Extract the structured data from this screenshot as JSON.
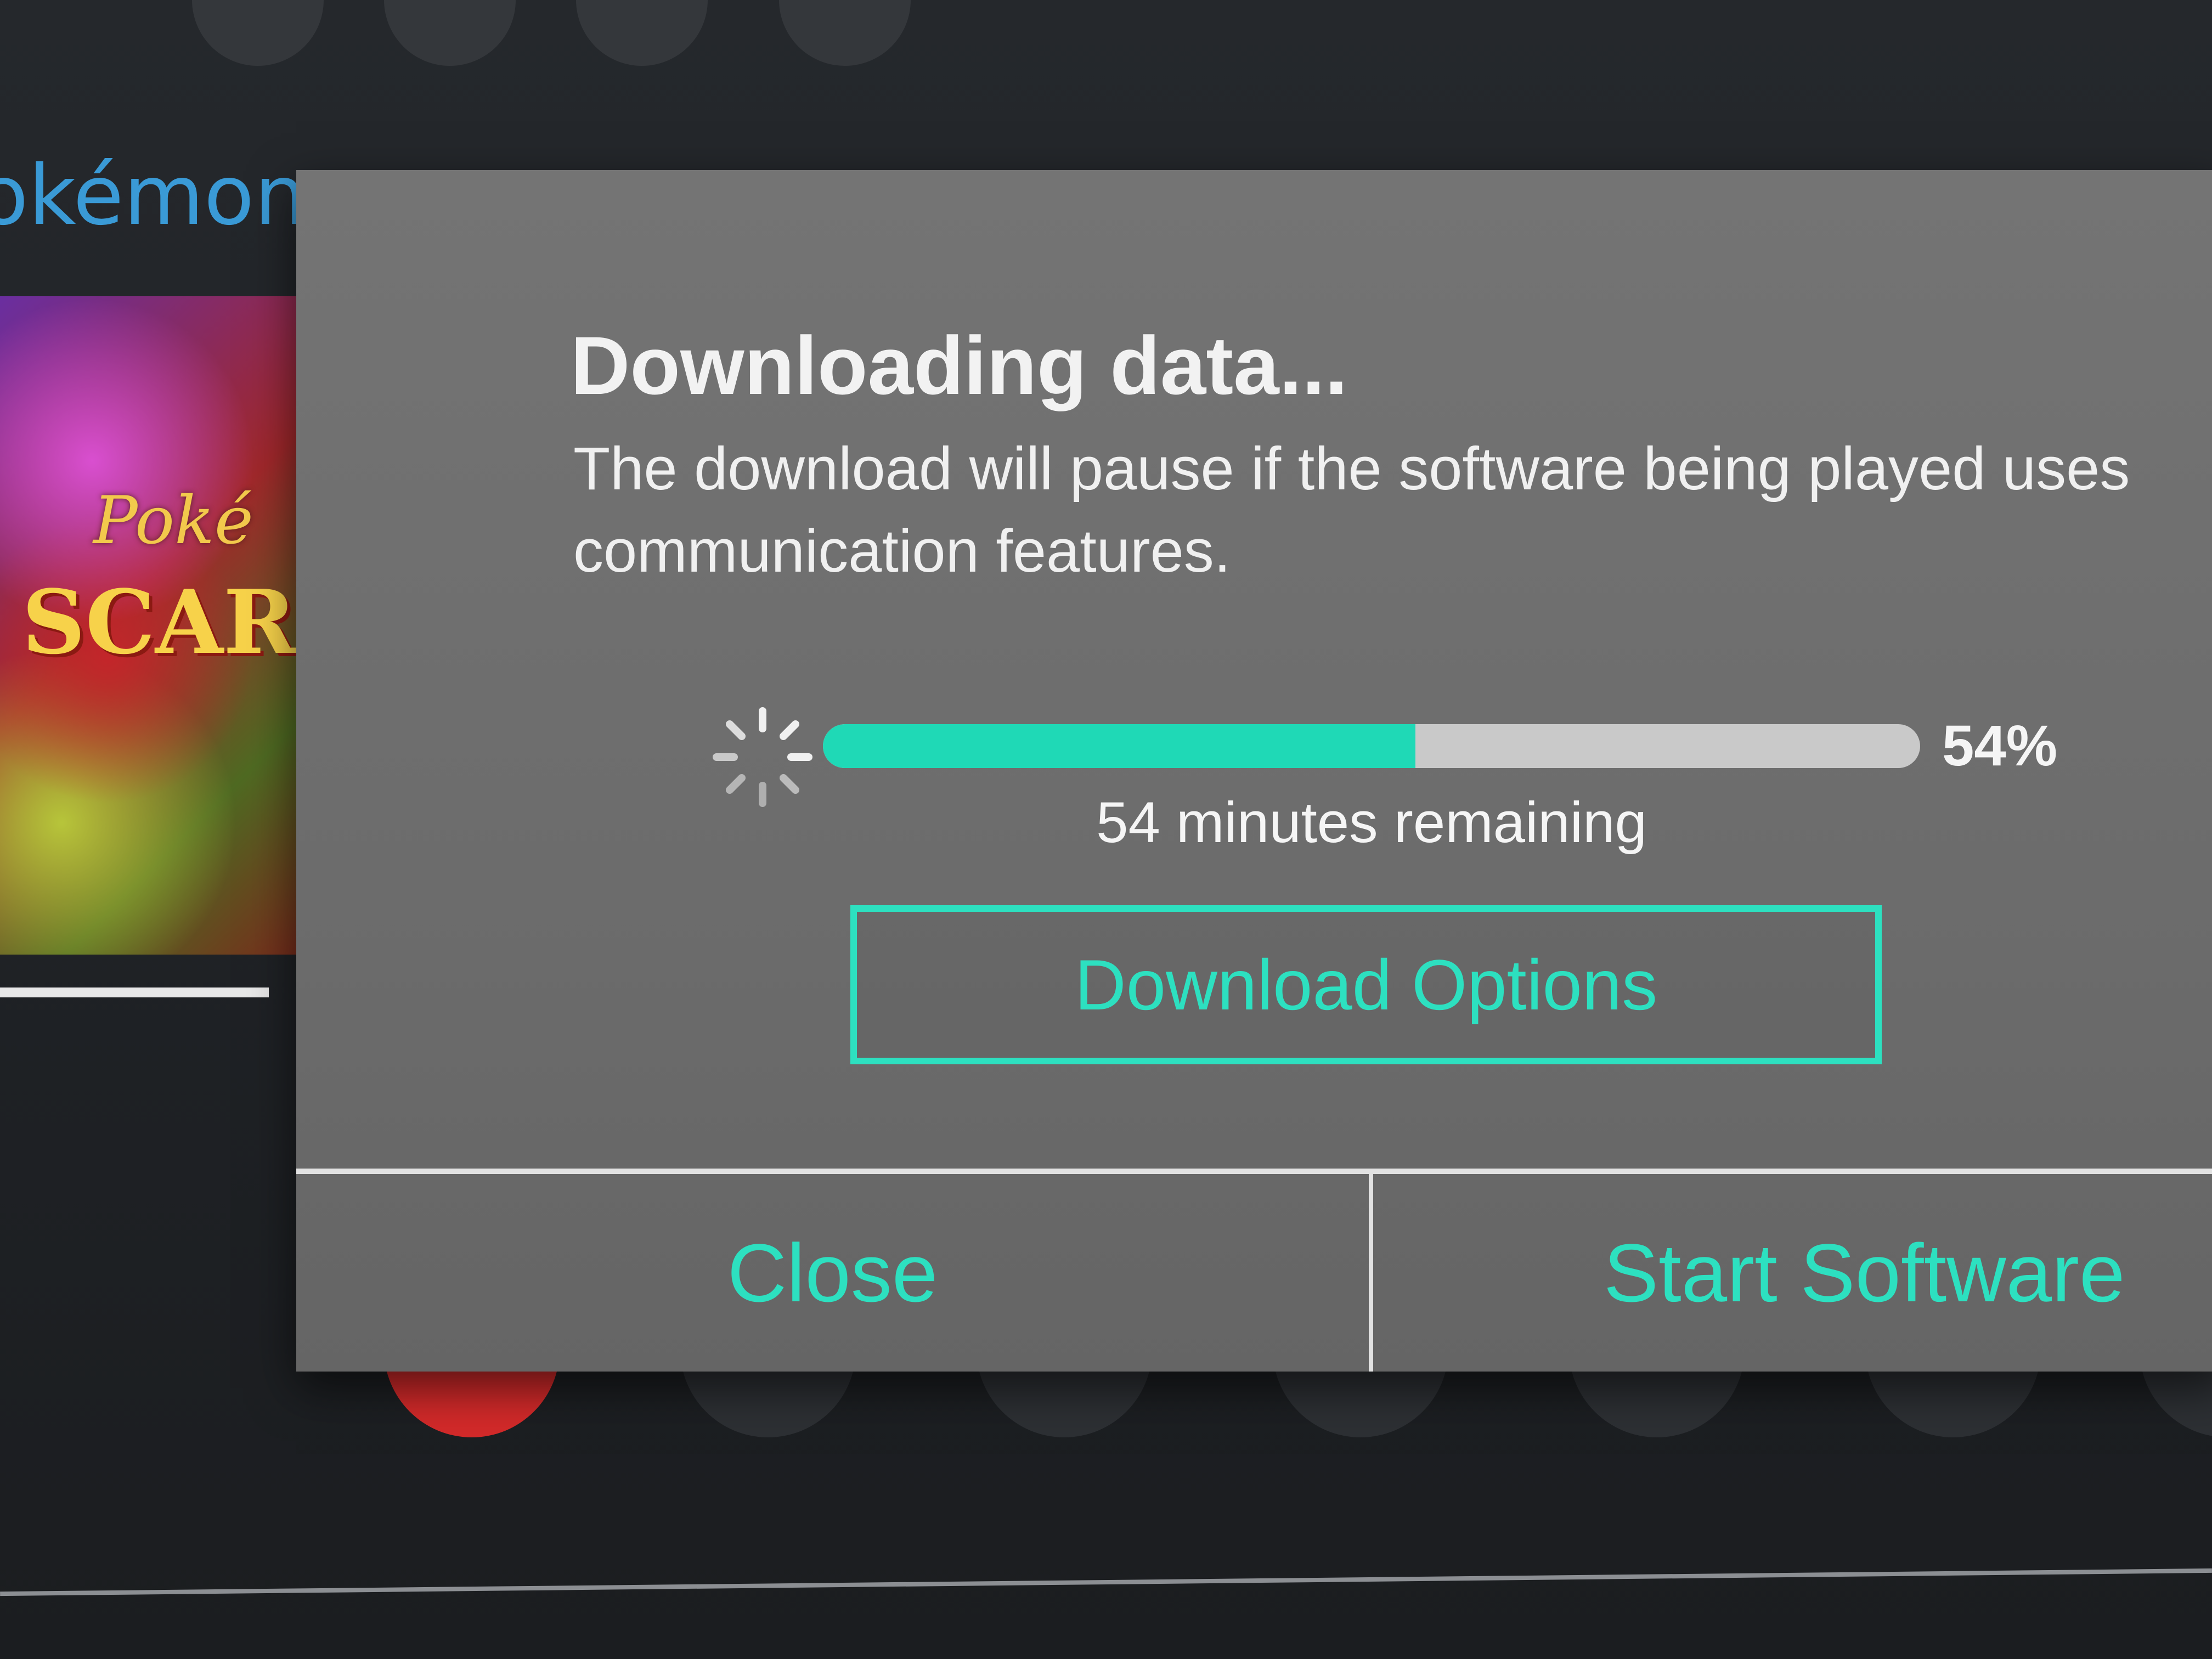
{
  "background": {
    "game_title": "okémon",
    "tile_logo_small": "Poké",
    "tile_logo_big": "SCARL"
  },
  "dialog": {
    "title": "Downloading data...",
    "message": "The download will pause if the software being played uses communication features.",
    "progress": {
      "percent_value": 54,
      "percent_label": "54%",
      "time_remaining": "54 minutes remaining",
      "icon": "loading-spinner-icon"
    },
    "download_options_label": "Download Options",
    "footer": {
      "close_label": "Close",
      "start_label": "Start Software"
    }
  },
  "colors": {
    "accent": "#2de0c0",
    "progress_fill": "#1fd9b6",
    "progress_track": "#c9c9c9",
    "dialog_bg": "#6e6e6e",
    "text": "#f2f2f2"
  }
}
